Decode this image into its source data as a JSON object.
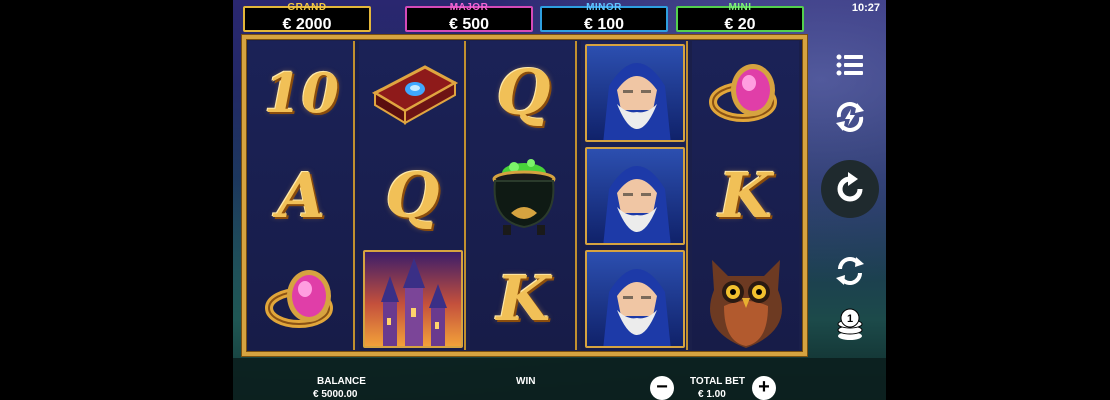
{
  "status": {
    "time": "10:27"
  },
  "jackpots": [
    {
      "title": "GRAND",
      "value": "€ 2000",
      "color": "#e3b63a"
    },
    {
      "title": "MAJOR",
      "value": "€ 500",
      "color": "#d44ab8"
    },
    {
      "title": "MINOR",
      "value": "€ 100",
      "color": "#2e9fe0"
    },
    {
      "title": "MINI",
      "value": "€ 20",
      "color": "#53d04e"
    }
  ],
  "reels": [
    [
      "10",
      "spellbook",
      "ring"
    ],
    [
      "spellbook",
      "Q",
      "castle"
    ],
    [
      "Q",
      "cauldron",
      "K"
    ],
    [
      "wizard",
      "wizard",
      "wizard"
    ],
    [
      "ring",
      "K",
      "owl"
    ]
  ],
  "reel_text": {
    "r0c0": "10",
    "r0c1": "A",
    "r1c1": "Q",
    "r2c0": "Q",
    "r2c2": "K",
    "r4c1": "K"
  },
  "side_buttons": [
    "menu-icon",
    "turbo-icon",
    "spin-icon",
    "autoplay-icon",
    "bet-coins-icon"
  ],
  "bottom": {
    "balance_label": "BALANCE",
    "balance_value": "€ 5000.00",
    "win_label": "WIN",
    "total_bet_label": "TOTAL BET",
    "total_bet_value": "€ 1.00",
    "minus": "−",
    "plus": "+"
  }
}
